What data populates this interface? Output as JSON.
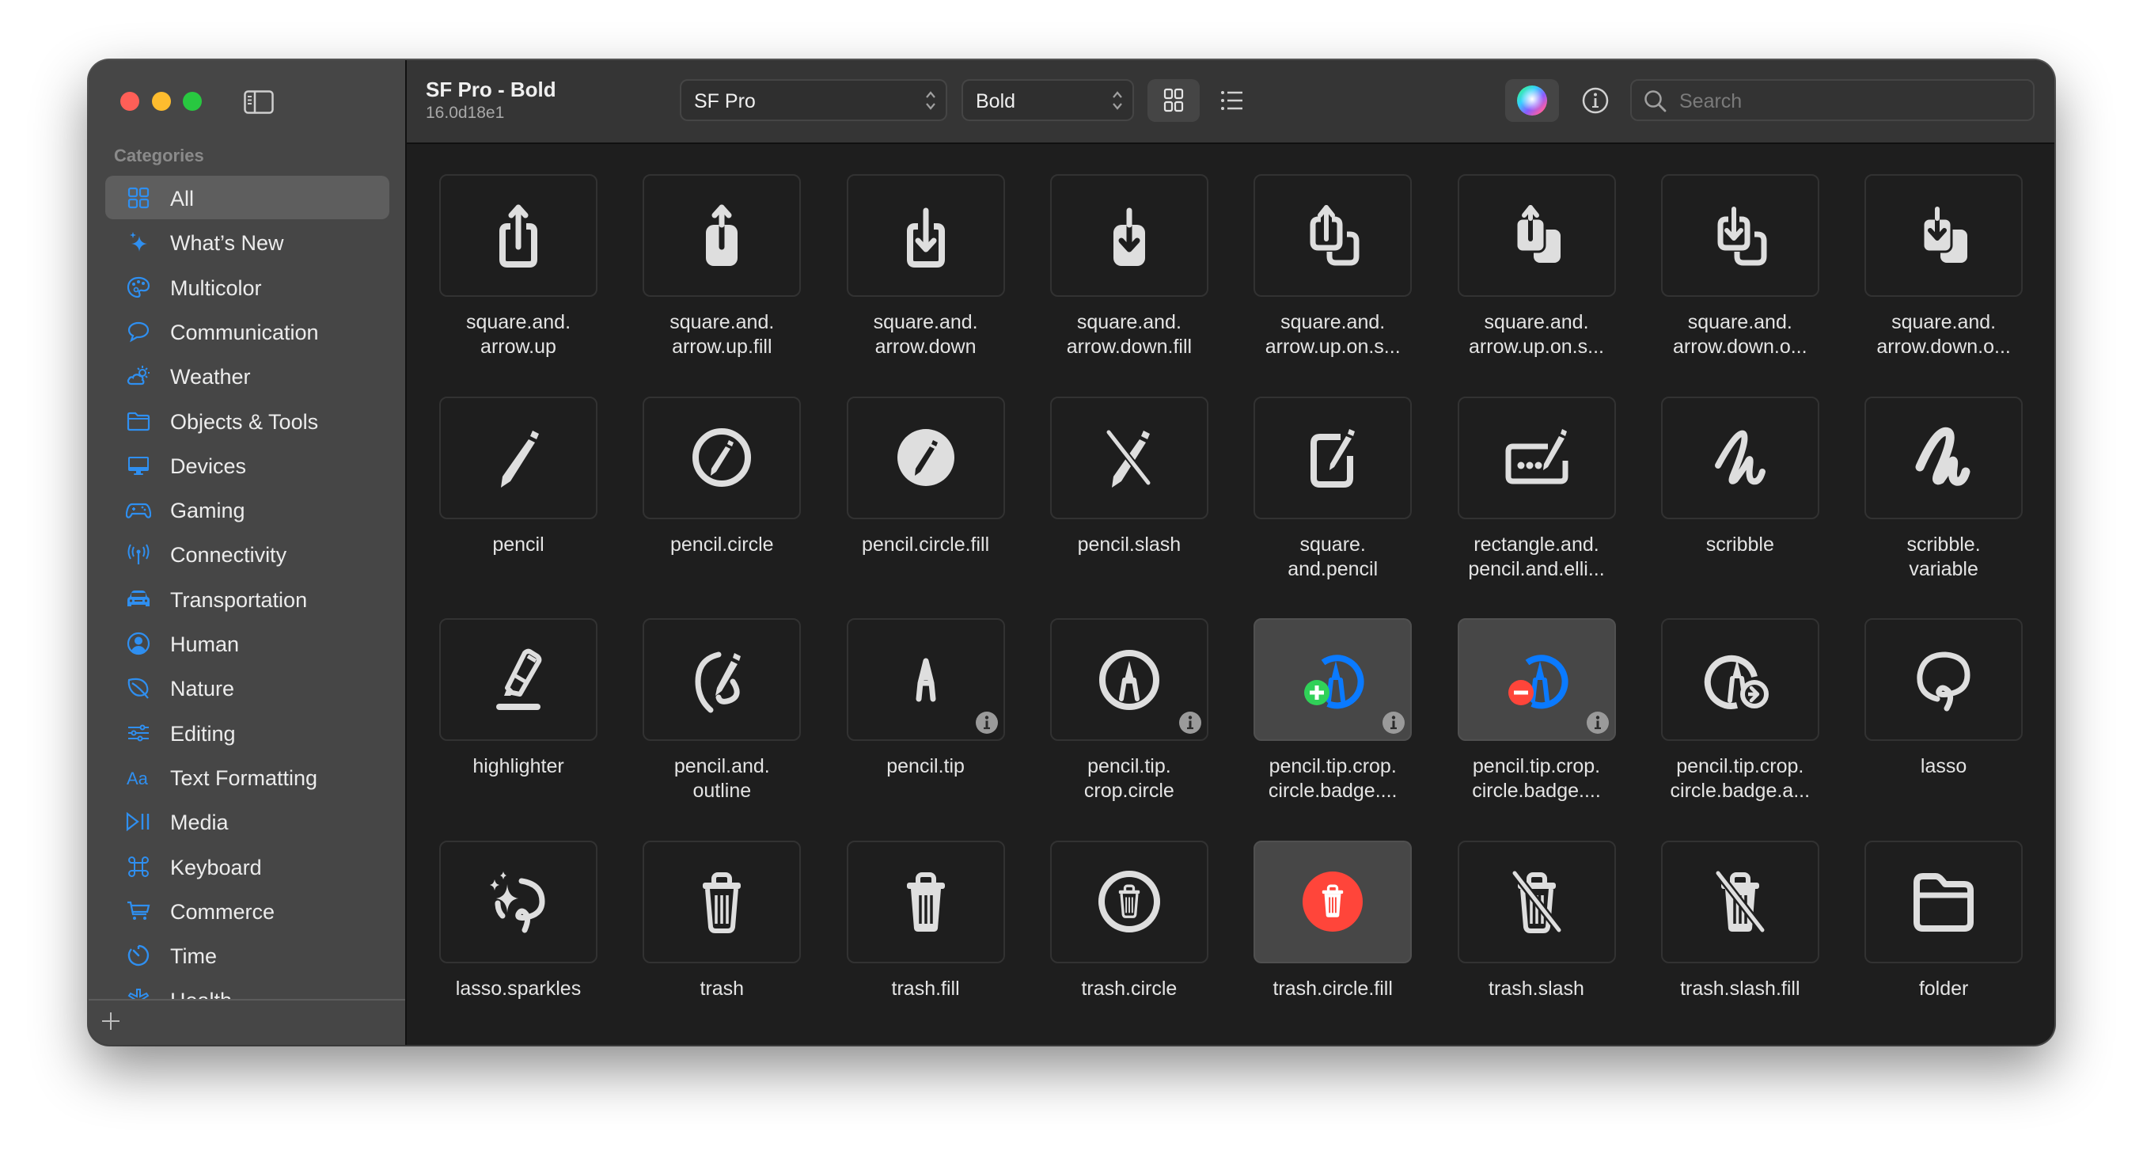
{
  "window": {
    "title": "SF Pro - Bold",
    "subtitle": "16.0d18e1"
  },
  "sidebar": {
    "section_label": "Categories",
    "items": [
      {
        "label": "All",
        "icon": "square-grid-2x2-icon",
        "selected": true
      },
      {
        "label": "What’s New",
        "icon": "sparkles-icon"
      },
      {
        "label": "Multicolor",
        "icon": "paintpalette-icon"
      },
      {
        "label": "Communication",
        "icon": "message-bubble-icon"
      },
      {
        "label": "Weather",
        "icon": "cloud-sun-icon"
      },
      {
        "label": "Objects & Tools",
        "icon": "folder-icon"
      },
      {
        "label": "Devices",
        "icon": "desktopcomputer-icon"
      },
      {
        "label": "Gaming",
        "icon": "gamecontroller-icon"
      },
      {
        "label": "Connectivity",
        "icon": "antenna-radiowaves-icon"
      },
      {
        "label": "Transportation",
        "icon": "car-icon"
      },
      {
        "label": "Human",
        "icon": "person-crop-circle-icon"
      },
      {
        "label": "Nature",
        "icon": "leaf-icon"
      },
      {
        "label": "Editing",
        "icon": "slider-horizontal-icon"
      },
      {
        "label": "Text Formatting",
        "icon": "textformat-icon"
      },
      {
        "label": "Media",
        "icon": "playpause-icon"
      },
      {
        "label": "Keyboard",
        "icon": "command-icon"
      },
      {
        "label": "Commerce",
        "icon": "cart-icon"
      },
      {
        "label": "Time",
        "icon": "timer-icon"
      },
      {
        "label": "Health",
        "icon": "staroflife-icon"
      }
    ],
    "add_label": "+"
  },
  "toolbar": {
    "font_popup": {
      "value": "SF Pro"
    },
    "weight_popup": {
      "value": "Bold"
    },
    "view_grid": {
      "icon": "square-grid-2x2-icon",
      "selected": true
    },
    "view_list": {
      "icon": "list-bullet-icon"
    },
    "color_button": {
      "icon": "color-wheel-icon"
    },
    "info_button": {
      "icon": "info-circle-icon"
    },
    "search": {
      "placeholder": "Search",
      "value": ""
    }
  },
  "colors": {
    "accent": "#2f8ff0",
    "blue_symbol": "#0a7aff",
    "green_badge": "#30d158",
    "red_badge": "#ff453a"
  },
  "symbols": [
    {
      "line1": "square.and.",
      "line2": "arrow.up",
      "glyph": "sq-up"
    },
    {
      "line1": "square.and.",
      "line2": "arrow.up.fill",
      "glyph": "sq-up-fill"
    },
    {
      "line1": "square.and.",
      "line2": "arrow.down",
      "glyph": "sq-down"
    },
    {
      "line1": "square.and.",
      "line2": "arrow.down.fill",
      "glyph": "sq-down-fill"
    },
    {
      "line1": "square.and.",
      "line2": "arrow.up.on.s...",
      "glyph": "sq2-up"
    },
    {
      "line1": "square.and.",
      "line2": "arrow.up.on.s...",
      "glyph": "sq2-up-fill"
    },
    {
      "line1": "square.and.",
      "line2": "arrow.down.o...",
      "glyph": "sq2-down"
    },
    {
      "line1": "square.and.",
      "line2": "arrow.down.o...",
      "glyph": "sq2-down-fill"
    },
    {
      "line1": "pencil",
      "line2": "",
      "glyph": "pencil"
    },
    {
      "line1": "pencil.circle",
      "line2": "",
      "glyph": "pencil-circle"
    },
    {
      "line1": "pencil.circle.fill",
      "line2": "",
      "glyph": "pencil-circle-fill"
    },
    {
      "line1": "pencil.slash",
      "line2": "",
      "glyph": "pencil-slash"
    },
    {
      "line1": "square.",
      "line2": "and.pencil",
      "glyph": "square-pencil"
    },
    {
      "line1": "rectangle.and.",
      "line2": "pencil.and.elli...",
      "glyph": "rect-pencil"
    },
    {
      "line1": "scribble",
      "line2": "",
      "glyph": "scribble"
    },
    {
      "line1": "scribble.",
      "line2": "variable",
      "glyph": "scribble-var"
    },
    {
      "line1": "highlighter",
      "line2": "",
      "glyph": "highlighter"
    },
    {
      "line1": "pencil.and.",
      "line2": "outline",
      "glyph": "pencil-outline"
    },
    {
      "line1": "pencil.tip",
      "line2": "",
      "glyph": "pencil-tip",
      "info": true
    },
    {
      "line1": "pencil.tip.",
      "line2": "crop.circle",
      "glyph": "tip-circle",
      "info": true
    },
    {
      "line1": "pencil.tip.crop.",
      "line2": "circle.badge....",
      "glyph": "tip-badge-plus",
      "info": true,
      "highlighted": true
    },
    {
      "line1": "pencil.tip.crop.",
      "line2": "circle.badge....",
      "glyph": "tip-badge-minus",
      "info": true,
      "highlighted": true
    },
    {
      "line1": "pencil.tip.crop.",
      "line2": "circle.badge.a...",
      "glyph": "tip-badge-arrow"
    },
    {
      "line1": "lasso",
      "line2": "",
      "glyph": "lasso"
    },
    {
      "line1": "lasso.sparkles",
      "line2": "",
      "glyph": "lasso-sparkles"
    },
    {
      "line1": "trash",
      "line2": "",
      "glyph": "trash"
    },
    {
      "line1": "trash.fill",
      "line2": "",
      "glyph": "trash-fill"
    },
    {
      "line1": "trash.circle",
      "line2": "",
      "glyph": "trash-circle"
    },
    {
      "line1": "trash.circle.fill",
      "line2": "",
      "glyph": "trash-circle-fill",
      "highlighted": true
    },
    {
      "line1": "trash.slash",
      "line2": "",
      "glyph": "trash-slash"
    },
    {
      "line1": "trash.slash.fill",
      "line2": "",
      "glyph": "trash-slash-fill"
    },
    {
      "line1": "folder",
      "line2": "",
      "glyph": "folder"
    }
  ]
}
